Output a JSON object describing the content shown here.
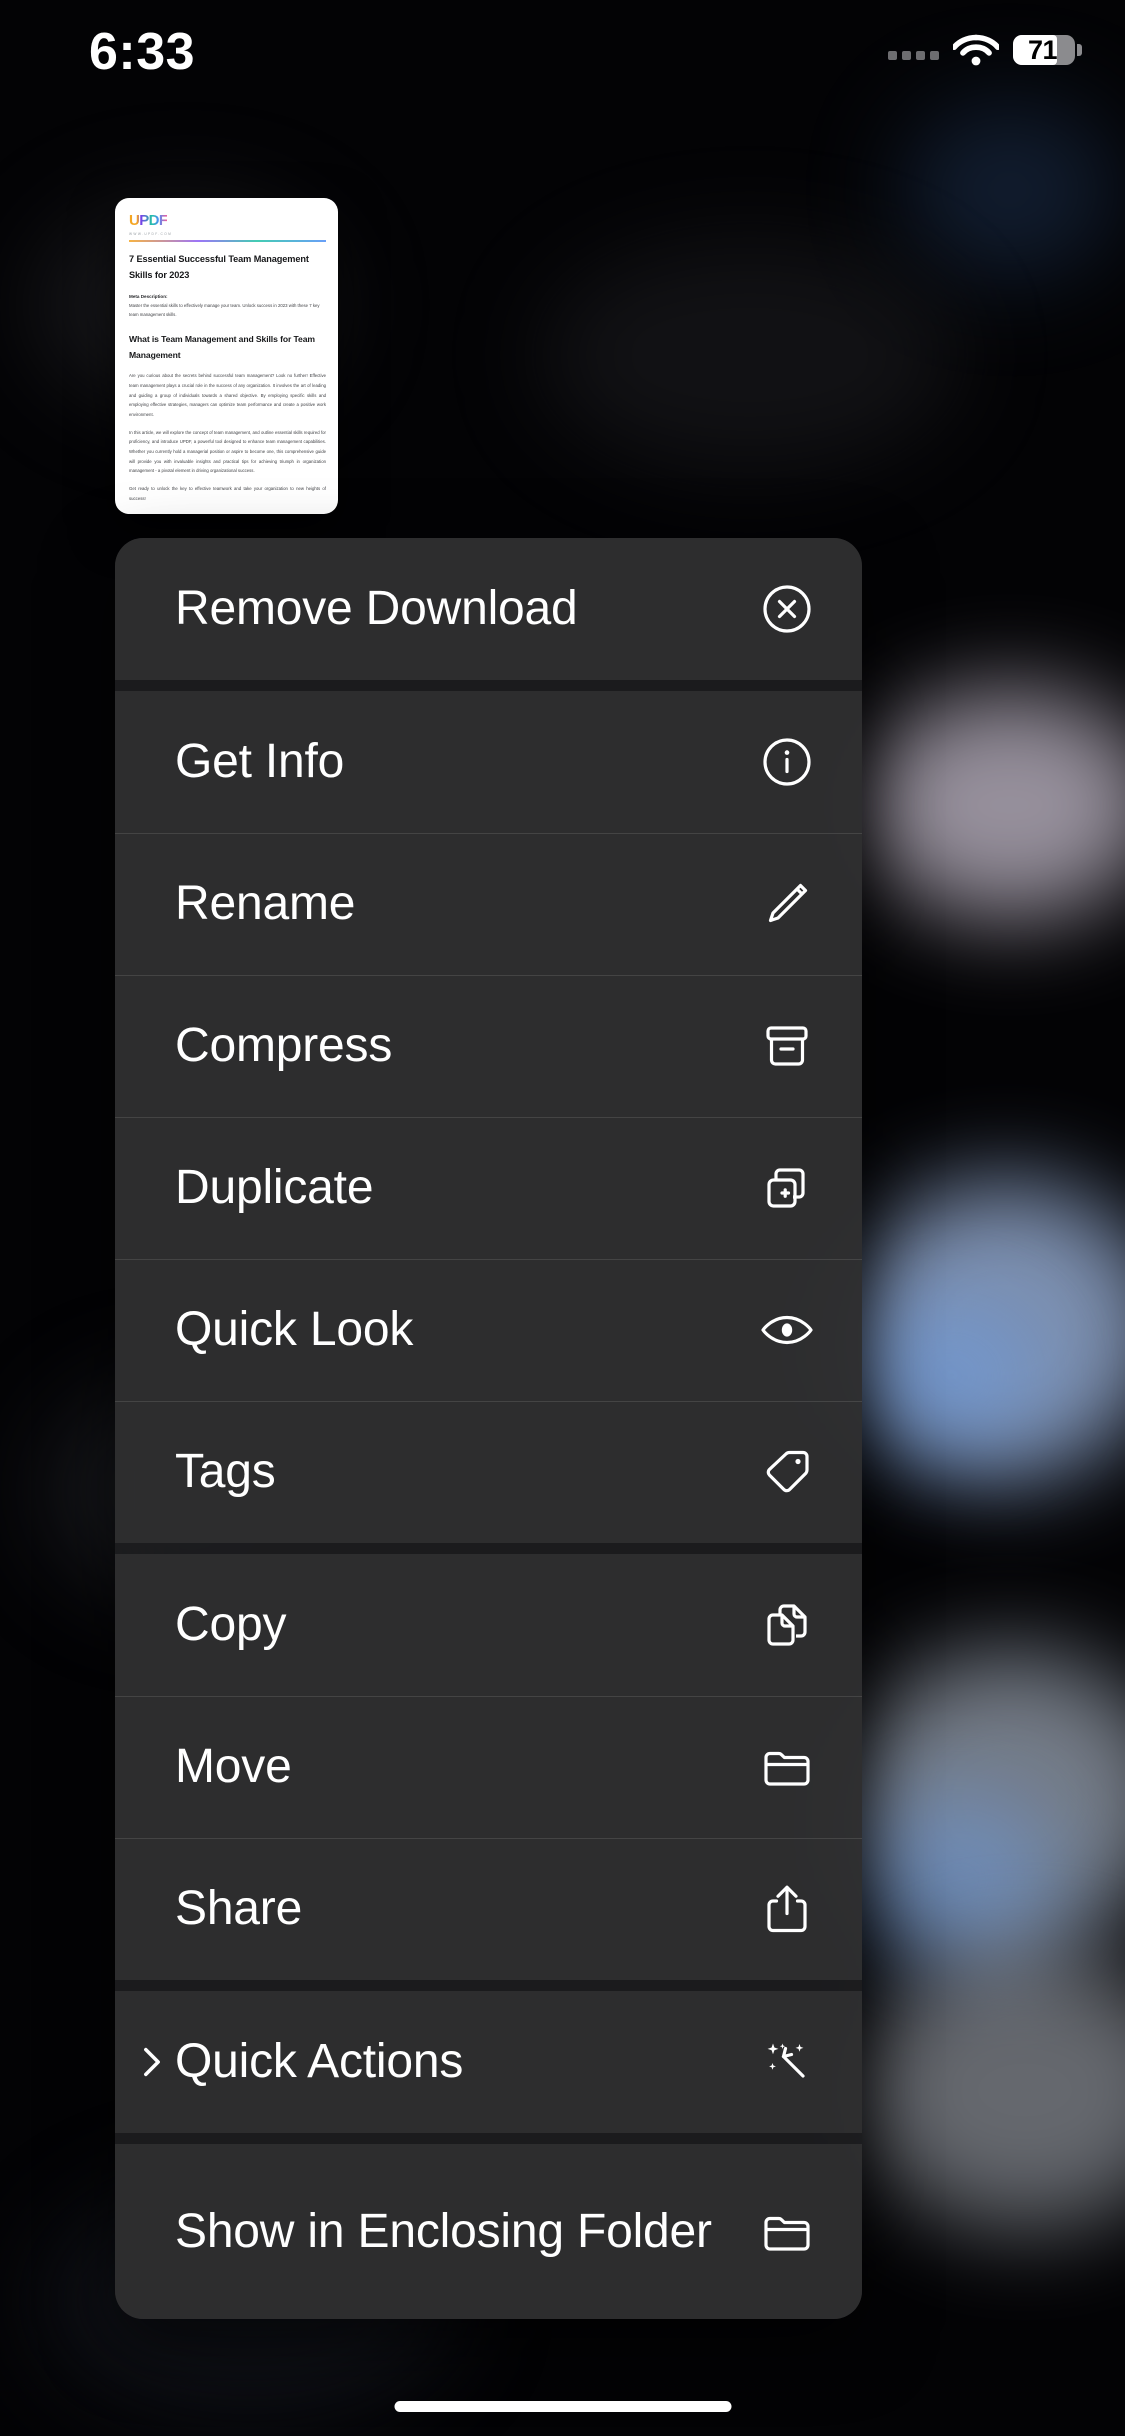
{
  "status_bar": {
    "time": "6:33",
    "battery_level": "71",
    "battery_percent": 71,
    "wifi_icon": "wifi-icon",
    "signal_icon": "signal-dots-icon",
    "battery_icon": "battery-icon"
  },
  "document_preview": {
    "logo": "UPDF",
    "logo_subtitle": "WWW.UPDF.COM",
    "title": "7 Essential Successful Team Management Skills for 2023",
    "meta_label": "Meta Description:",
    "meta_body": "Master the essential skills to effectively manage your team. Unlock success in 2023 with these 7 key team management skills.",
    "heading2": "What is Team Management and Skills for Team Management",
    "paragraph1": "Are you curious about the secrets behind successful team management? Look no further! Effective team management plays a crucial role in the success of any organization. It involves the art of leading and guiding a group of individuals towards a shared objective. By employing specific skills and employing effective strategies, managers can optimize team performance and create a positive work environment.",
    "paragraph2": "In this article, we will explore the concept of team management, and outline essential skills required for proficiency, and introduce UPDF, a powerful tool designed to enhance team management capabilities. Whether you currently hold a managerial position or aspire to become one, this comprehensive guide will provide you with invaluable insights and practical tips for achieving triumph in organization management - a pivotal element in driving organizational success.",
    "paragraph3": "Get ready to unlock the key to effective teamwork and take your organization to new heights of success!"
  },
  "context_menu": {
    "groups": [
      {
        "items": [
          {
            "label": "Remove Download",
            "icon": "x-circle-icon",
            "has_chevron": false
          }
        ]
      },
      {
        "items": [
          {
            "label": "Get Info",
            "icon": "info-circle-icon",
            "has_chevron": false
          },
          {
            "label": "Rename",
            "icon": "pencil-icon",
            "has_chevron": false
          },
          {
            "label": "Compress",
            "icon": "archivebox-icon",
            "has_chevron": false
          },
          {
            "label": "Duplicate",
            "icon": "plus-square-on-square-icon",
            "has_chevron": false
          },
          {
            "label": "Quick Look",
            "icon": "eye-icon",
            "has_chevron": false
          },
          {
            "label": "Tags",
            "icon": "tag-icon",
            "has_chevron": false
          }
        ]
      },
      {
        "items": [
          {
            "label": "Copy",
            "icon": "doc-on-doc-icon",
            "has_chevron": false
          },
          {
            "label": "Move",
            "icon": "folder-icon",
            "has_chevron": false
          },
          {
            "label": "Share",
            "icon": "share-up-icon",
            "has_chevron": false
          }
        ]
      },
      {
        "items": [
          {
            "label": "Quick Actions",
            "icon": "wand-sparkles-icon",
            "has_chevron": true
          }
        ]
      },
      {
        "items": [
          {
            "label": "Show in Enclosing Folder",
            "icon": "folder-icon",
            "has_chevron": false,
            "tall": true
          }
        ]
      }
    ]
  },
  "home_indicator": {
    "name": "home-indicator"
  },
  "colors": {
    "background": "#030305",
    "menu_background": "#2a2a2c",
    "menu_item_background": "#303032",
    "separator": "#ffffff1c",
    "text": "#ffffff",
    "battery_fill": "#ffffff",
    "blob_lavender": "#cfc6d6",
    "blob_blue": "#7ba4e0",
    "blob_white": "#cfd4dc"
  }
}
